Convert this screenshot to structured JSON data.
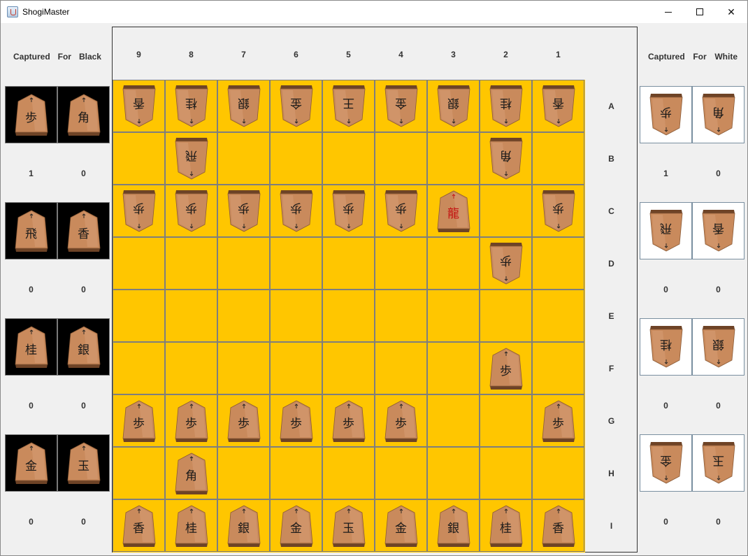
{
  "window": {
    "title": "ShogiMaster"
  },
  "black_panel": {
    "header": [
      "Captured",
      "For",
      "Black"
    ],
    "rows": [
      {
        "pieces": [
          "歩",
          "角"
        ],
        "counts": [
          "1",
          "0"
        ]
      },
      {
        "pieces": [
          "飛",
          "香"
        ],
        "counts": [
          "0",
          "0"
        ]
      },
      {
        "pieces": [
          "桂",
          "銀"
        ],
        "counts": [
          "0",
          "0"
        ]
      },
      {
        "pieces": [
          "金",
          "玉"
        ],
        "counts": [
          "0",
          "0"
        ]
      }
    ]
  },
  "white_panel": {
    "header": [
      "Captured",
      "For",
      "White"
    ],
    "rows": [
      {
        "pieces": [
          "歩",
          "角"
        ],
        "counts": [
          "1",
          "0"
        ]
      },
      {
        "pieces": [
          "飛",
          "香"
        ],
        "counts": [
          "0",
          "0"
        ]
      },
      {
        "pieces": [
          "桂",
          "銀"
        ],
        "counts": [
          "0",
          "0"
        ]
      },
      {
        "pieces": [
          "金",
          "玉"
        ],
        "counts": [
          "0",
          "0"
        ]
      }
    ]
  },
  "board": {
    "files": [
      "9",
      "8",
      "7",
      "6",
      "5",
      "4",
      "3",
      "2",
      "1"
    ],
    "ranks": [
      "A",
      "B",
      "C",
      "D",
      "E",
      "F",
      "G",
      "H",
      "I"
    ],
    "cells": [
      [
        "W:香",
        "W:桂",
        "W:銀",
        "W:金",
        "W:王",
        "W:金",
        "W:銀",
        "W:桂",
        "W:香"
      ],
      [
        "",
        "W:飛",
        "",
        "",
        "",
        "",
        "",
        "W:角",
        ""
      ],
      [
        "W:歩",
        "W:歩",
        "W:歩",
        "W:歩",
        "W:歩",
        "W:歩",
        "B:龍",
        "",
        "W:歩"
      ],
      [
        "",
        "",
        "",
        "",
        "",
        "",
        "",
        "W:歩",
        ""
      ],
      [
        "",
        "",
        "",
        "",
        "",
        "",
        "",
        "",
        ""
      ],
      [
        "",
        "",
        "",
        "",
        "",
        "",
        "",
        "B:歩",
        ""
      ],
      [
        "B:歩",
        "B:歩",
        "B:歩",
        "B:歩",
        "B:歩",
        "B:歩",
        "",
        "",
        "B:歩"
      ],
      [
        "",
        "B:角",
        "",
        "",
        "",
        "",
        "",
        "",
        ""
      ],
      [
        "B:香",
        "B:桂",
        "B:銀",
        "B:金",
        "B:玉",
        "B:金",
        "B:銀",
        "B:桂",
        "B:香"
      ]
    ],
    "promoted": [
      "龍"
    ]
  },
  "colors": {
    "board_fill": "#ffc600",
    "grid_line": "#7e7e7e",
    "piece_wood": "#c98a5c",
    "promoted_text": "#c41212"
  }
}
